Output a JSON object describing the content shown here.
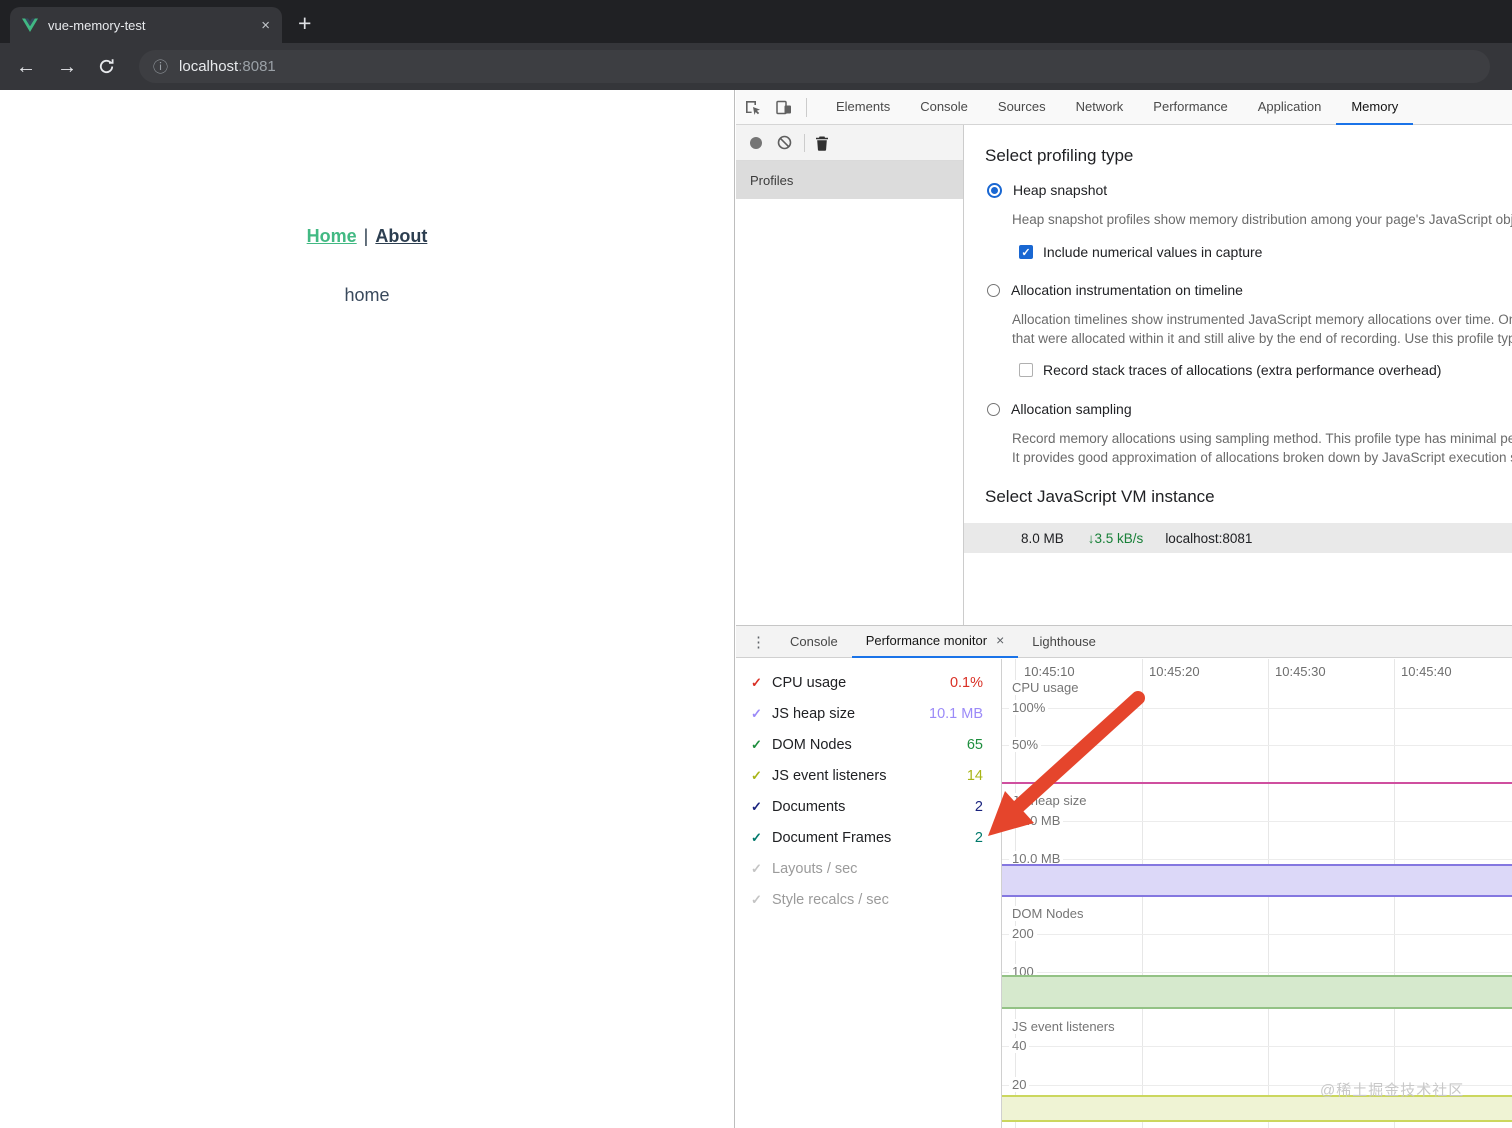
{
  "icons": {
    "close": "×",
    "new_tab": "+",
    "back": "←",
    "forward": "→",
    "info": "ⓘ",
    "overflow": "⋮",
    "check": "✓",
    "down_arrow": "↓"
  },
  "colors": {
    "accent_blue": "#1a73e8",
    "vue_green": "#42b983",
    "arrow_red": "#e5452c",
    "vm_rate_green": "#188038",
    "cpu_line_pink": "#cf4f9f",
    "heap_band": "#8477e0",
    "dom_band": "#93c285",
    "listeners_band": "#cbd75e"
  },
  "browser": {
    "tab_title": "vue-memory-test",
    "url_host": "localhost",
    "url_port": ":8081"
  },
  "page": {
    "nav_home": "Home",
    "nav_separator": "|",
    "nav_about": "About",
    "body_text": "home"
  },
  "devtools": {
    "tabs": [
      "Elements",
      "Console",
      "Sources",
      "Network",
      "Performance",
      "Application",
      "Memory"
    ],
    "active_tab": "Memory",
    "profiles_panel": {
      "header": "Profiles"
    },
    "memory": {
      "profiling_heading": "Select profiling type",
      "heap": {
        "label": "Heap snapshot",
        "desc": "Heap snapshot profiles show memory distribution among your page's JavaScript objects and related DOM nodes.",
        "checkbox_label": "Include numerical values in capture"
      },
      "allocation_timeline": {
        "label": "Allocation instrumentation on timeline",
        "desc_line1": "Allocation timelines show instrumented JavaScript memory allocations over time. Once profile is recorded you can select objects",
        "desc_line2": "that were allocated within it and still alive by the end of recording. Use this profile type to isolate memory leaks.",
        "checkbox_label": "Record stack traces of allocations (extra performance overhead)"
      },
      "allocation_sampling": {
        "label": "Allocation sampling",
        "desc_line1": "Record memory allocations using sampling method. This profile type has minimal performance overhead and can be used",
        "desc_line2": "It provides good approximation of allocations broken down by JavaScript execution stack."
      },
      "vm_heading": "Select JavaScript VM instance",
      "vm_row": {
        "size": "8.0 MB",
        "rate": "3.5 kB/s",
        "host": "localhost:8081"
      }
    },
    "drawer": {
      "tabs": [
        "Console",
        "Performance monitor",
        "Lighthouse"
      ],
      "active_tab": "Performance monitor",
      "metrics": [
        {
          "label": "CPU usage",
          "value": "0.1%",
          "color": "#d93025",
          "active": true
        },
        {
          "label": "JS heap size",
          "value": "10.1 MB",
          "color": "#9b8af8",
          "active": true
        },
        {
          "label": "DOM Nodes",
          "value": "65",
          "color": "#1e8e3e",
          "active": true
        },
        {
          "label": "JS event listeners",
          "value": "14",
          "color": "#a8b518",
          "active": true
        },
        {
          "label": "Documents",
          "value": "2",
          "color": "#1a237e",
          "active": true
        },
        {
          "label": "Document Frames",
          "value": "2",
          "color": "#00796b",
          "active": true
        },
        {
          "label": "Layouts / sec",
          "value": "",
          "color": "#c4c4c4",
          "active": false
        },
        {
          "label": "Style recalcs / sec",
          "value": "",
          "color": "#c4c4c4",
          "active": false
        }
      ],
      "chart": {
        "time_labels": [
          "10:45:10",
          "10:45:20",
          "10:45:30",
          "10:45:40"
        ],
        "sections": {
          "cpu": {
            "label": "CPU usage",
            "grid1": "100%",
            "grid2": "50%"
          },
          "heap": {
            "label": "JS heap size",
            "grid1": "20.0 MB",
            "grid2": "10.0 MB"
          },
          "dom": {
            "label": "DOM Nodes",
            "grid1": "200",
            "grid2": "100"
          },
          "listeners": {
            "label": "JS event listeners",
            "grid1": "40",
            "grid2": "20"
          }
        }
      }
    }
  },
  "watermark": "@稀土掘金技术社区",
  "chart_data": {
    "type": "area",
    "title": "Performance monitor",
    "x_ticks": [
      "10:45:10",
      "10:45:20",
      "10:45:30",
      "10:45:40"
    ],
    "grid": true,
    "series": [
      {
        "name": "CPU usage",
        "unit": "%",
        "ylim": [
          0,
          100
        ],
        "gridlines": [
          100,
          50
        ],
        "values": [
          0.1,
          0.1,
          0.1,
          0.1
        ]
      },
      {
        "name": "JS heap size",
        "unit": "MB",
        "ylim": [
          0,
          30
        ],
        "gridlines": [
          20,
          10
        ],
        "values": [
          10.1,
          10.1,
          10.1,
          10.1
        ]
      },
      {
        "name": "DOM Nodes",
        "unit": "",
        "ylim": [
          0,
          300
        ],
        "gridlines": [
          200,
          100
        ],
        "values": [
          90,
          90,
          90,
          90
        ],
        "current": 65
      },
      {
        "name": "JS event listeners",
        "unit": "",
        "ylim": [
          0,
          60
        ],
        "gridlines": [
          40,
          20
        ],
        "values": [
          14,
          14,
          14,
          14
        ]
      }
    ],
    "legend_position": "left"
  }
}
